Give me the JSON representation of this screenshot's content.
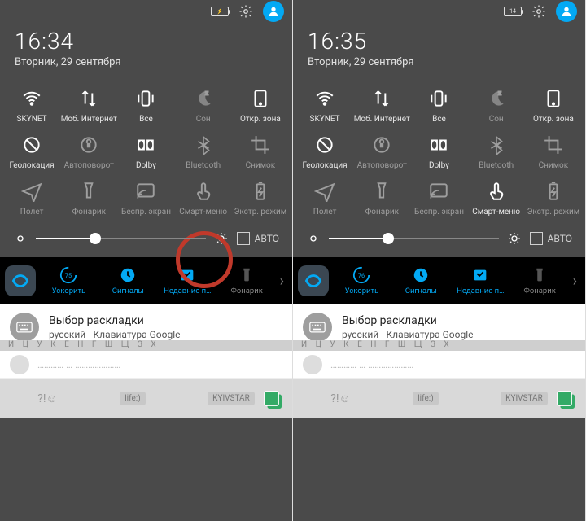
{
  "left": {
    "status": {
      "battery_label": "⚡"
    },
    "time": "16:34",
    "date": "Вторник, 29 сентября",
    "brightness": {
      "auto_label": "АВТО",
      "value_pct": 35
    },
    "circle_target_tile_index": 13
  },
  "right": {
    "status": {
      "battery_label": "14"
    },
    "time": "16:35",
    "date": "Вторник, 29 сентября",
    "brightness": {
      "auto_label": "АВТО",
      "value_pct": 35
    }
  },
  "tiles": [
    {
      "id": "wifi",
      "label": "SKYNET",
      "active": true,
      "icon": "wifi"
    },
    {
      "id": "mobile-data",
      "label": "Моб. Интернет",
      "active": true,
      "icon": "updown"
    },
    {
      "id": "dnd",
      "label": "Все",
      "active": true,
      "icon": "vibrate"
    },
    {
      "id": "sleep",
      "label": "Сон",
      "active": false,
      "icon": "moon"
    },
    {
      "id": "open-zone",
      "label": "Откр. зона",
      "active": true,
      "icon": "tablet"
    },
    {
      "id": "location",
      "label": "Геолокация",
      "active": true,
      "icon": "loc-off"
    },
    {
      "id": "autorotate",
      "label": "Автоповорот",
      "active": false,
      "icon": "lock-rotate"
    },
    {
      "id": "dolby",
      "label": "Dolby",
      "active": true,
      "icon": "dolby"
    },
    {
      "id": "bluetooth",
      "label": "Bluetooth",
      "active": false,
      "icon": "bluetooth"
    },
    {
      "id": "screenshot",
      "label": "Снимок",
      "active": false,
      "icon": "crop"
    },
    {
      "id": "airplane",
      "label": "Полет",
      "active": false,
      "icon": "plane"
    },
    {
      "id": "flashlight",
      "label": "Фонарик",
      "active": false,
      "icon": "flashlight"
    },
    {
      "id": "cast",
      "label": "Беспр. экран",
      "active": false,
      "icon": "cast"
    },
    {
      "id": "smart-menu",
      "label": "Смарт-меню",
      "active": false,
      "icon": "touch"
    },
    {
      "id": "powersave",
      "label": "Экстр. режим",
      "active": false,
      "icon": "battery-save"
    }
  ],
  "tiles_right_overrides": {
    "13": {
      "active": true
    }
  },
  "dock": {
    "items": [
      {
        "id": "boost",
        "label": "Ускорить",
        "percent": 75,
        "color": "accent"
      },
      {
        "id": "alarms",
        "label": "Сигналы",
        "color": "accent"
      },
      {
        "id": "recent",
        "label": "Недавние п…",
        "color": "accent"
      },
      {
        "id": "flashlight",
        "label": "Фонарик",
        "color": "muted"
      }
    ],
    "right_percent": 76
  },
  "notification": {
    "title": "Выбор раскладки",
    "subtitle": "русский - Клавиатура Google"
  },
  "bottom_chips": [
    "life:)",
    "KYIVSTAR"
  ],
  "colors": {
    "accent": "#03a9f4",
    "panel": "#4a4a4a"
  }
}
